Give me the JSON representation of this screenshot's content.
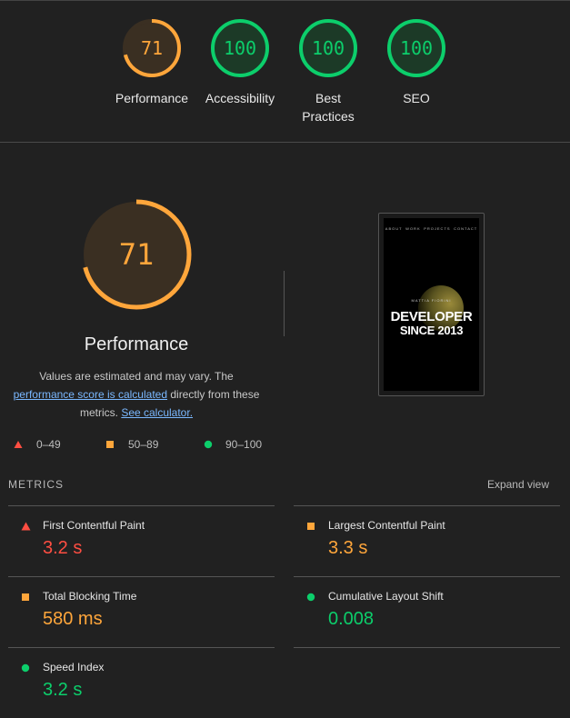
{
  "colors": {
    "fail": "#ff4e42",
    "average": "#ffa63b",
    "pass": "#0cce6b"
  },
  "top_scores": [
    {
      "score": "71",
      "label": "Performance",
      "status": "average",
      "fraction": 0.71
    },
    {
      "score": "100",
      "label": "Accessibility",
      "status": "pass",
      "fraction": 1.0
    },
    {
      "score": "100",
      "label": "Best\nPractices",
      "status": "pass",
      "fraction": 1.0
    },
    {
      "score": "100",
      "label": "SEO",
      "status": "pass",
      "fraction": 1.0
    }
  ],
  "performance": {
    "score": "71",
    "fraction": 0.71,
    "title": "Performance",
    "desc_part1": "Values are estimated and may vary. The ",
    "desc_link1": "performance score is calculated",
    "desc_part2": " directly from these metrics. ",
    "desc_link2": "See calculator."
  },
  "legend": [
    {
      "range": "0–49",
      "shape": "triangle",
      "status": "fail"
    },
    {
      "range": "50–89",
      "shape": "square",
      "status": "average"
    },
    {
      "range": "90–100",
      "shape": "circle",
      "status": "pass"
    }
  ],
  "screenshot": {
    "nav": [
      "ABOUT",
      "WORK",
      "PROJECTS",
      "CONTACT"
    ],
    "subtitle": "MATTIA FIORINI",
    "headline1": "DEVELOPER",
    "headline2": "SINCE 2013"
  },
  "metrics": {
    "title": "METRICS",
    "expand": "Expand view",
    "items": [
      {
        "name": "First Contentful Paint",
        "value": "3.2 s",
        "status": "fail",
        "shape": "triangle"
      },
      {
        "name": "Largest Contentful Paint",
        "value": "3.3 s",
        "status": "average",
        "shape": "square"
      },
      {
        "name": "Total Blocking Time",
        "value": "580 ms",
        "status": "average",
        "shape": "square"
      },
      {
        "name": "Cumulative Layout Shift",
        "value": "0.008",
        "status": "pass",
        "shape": "circle"
      },
      {
        "name": "Speed Index",
        "value": "3.2 s",
        "status": "pass",
        "shape": "circle"
      }
    ]
  }
}
